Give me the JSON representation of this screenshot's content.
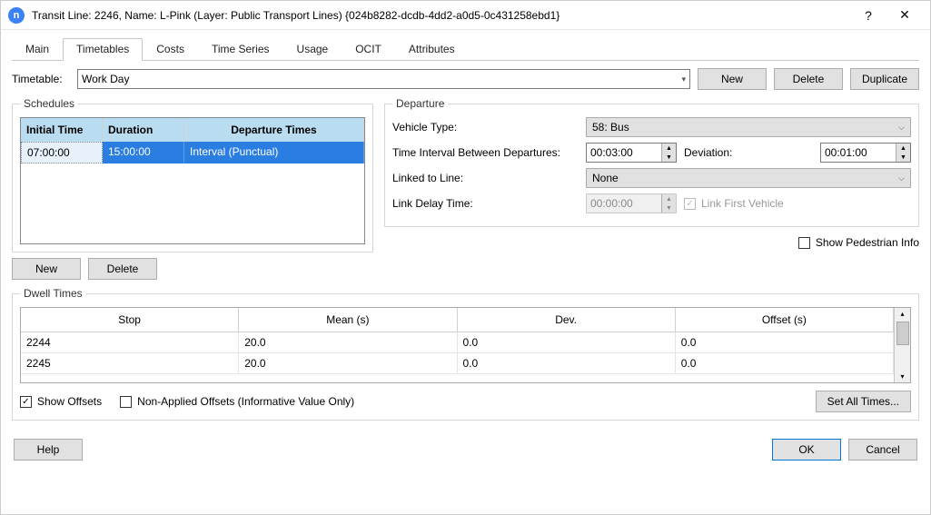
{
  "window": {
    "title": "Transit Line: 2246, Name: L-Pink (Layer: Public Transport Lines) {024b8282-dcdb-4dd2-a0d5-0c431258ebd1}"
  },
  "tabs": {
    "main": "Main",
    "timetables": "Timetables",
    "costs": "Costs",
    "timeseries": "Time Series",
    "usage": "Usage",
    "ocit": "OCIT",
    "attributes": "Attributes"
  },
  "timetable": {
    "label": "Timetable:",
    "selected": "Work Day",
    "new": "New",
    "delete": "Delete",
    "duplicate": "Duplicate"
  },
  "schedules": {
    "legend": "Schedules",
    "headers": {
      "initial": "Initial Time",
      "duration": "Duration",
      "departures": "Departure Times"
    },
    "row": {
      "initial": "07:00:00",
      "duration": "15:00:00",
      "departures": "Interval (Punctual)"
    },
    "new": "New",
    "delete": "Delete"
  },
  "departure": {
    "legend": "Departure",
    "vehicle_label": "Vehicle Type:",
    "vehicle_value": "58: Bus",
    "interval_label": "Time Interval Between Departures:",
    "interval_value": "00:03:00",
    "deviation_label": "Deviation:",
    "deviation_value": "00:01:00",
    "linked_label": "Linked to Line:",
    "linked_value": "None",
    "delay_label": "Link Delay Time:",
    "delay_value": "00:00:00",
    "link_first": "Link First Vehicle"
  },
  "show_ped": "Show Pedestrian Info",
  "dwell": {
    "legend": "Dwell Times",
    "headers": {
      "stop": "Stop",
      "mean": "Mean (s)",
      "dev": "Dev.",
      "offset": "Offset (s)"
    },
    "rows": [
      {
        "stop": "2244",
        "mean": "20.0",
        "dev": "0.0",
        "offset": "0.0"
      },
      {
        "stop": "2245",
        "mean": "20.0",
        "dev": "0.0",
        "offset": "0.0"
      }
    ],
    "show_offsets": "Show Offsets",
    "non_applied": "Non-Applied Offsets (Informative Value Only)",
    "set_all": "Set All Times..."
  },
  "footer": {
    "help": "Help",
    "ok": "OK",
    "cancel": "Cancel"
  }
}
